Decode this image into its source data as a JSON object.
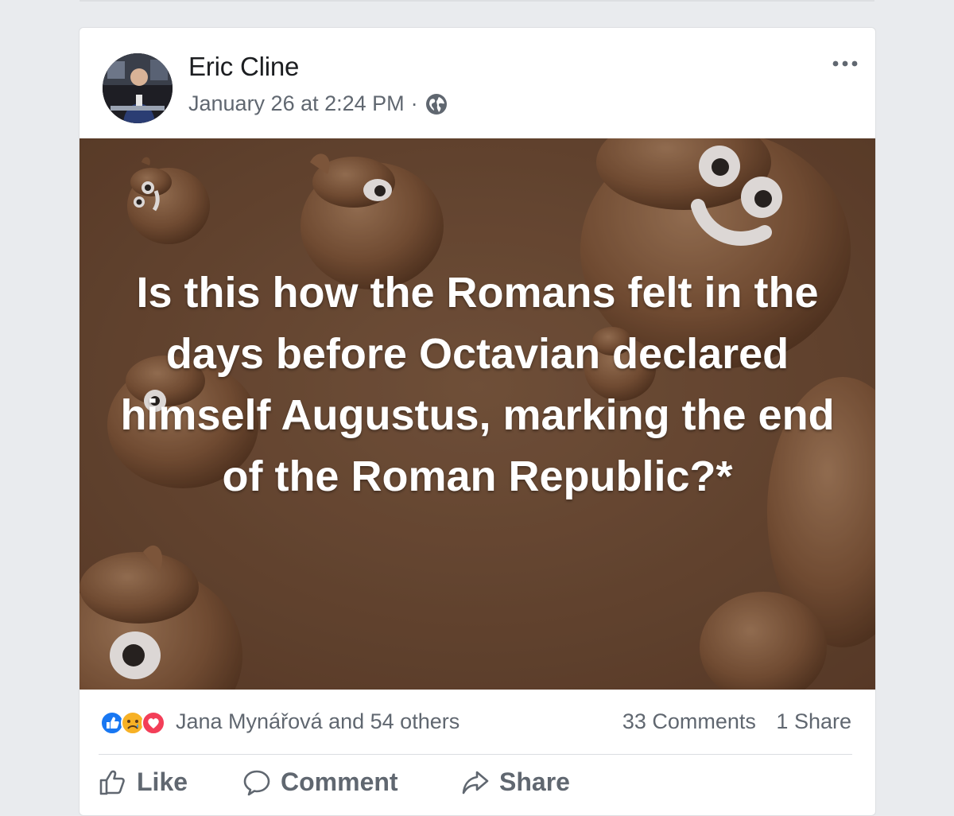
{
  "post": {
    "author": "Eric Cline",
    "timestamp": "January 26 at 2:24 PM",
    "separator": "·",
    "privacy_icon": "globe-icon",
    "options_icon": "more-icon",
    "image_text": "Is this how the Romans felt in the days before Octavian declared himself Augustus, marking the end of the Roman Republic?*"
  },
  "engagement": {
    "reaction_icons": [
      "like-reaction-icon",
      "sad-reaction-icon",
      "love-reaction-icon"
    ],
    "reactions_text": "Jana Mynářová and 54 others",
    "comments_text": "33 Comments",
    "shares_text": "1 Share"
  },
  "actions": {
    "like_label": "Like",
    "comment_label": "Comment",
    "share_label": "Share"
  },
  "colors": {
    "background": "#e9ebee",
    "card": "#ffffff",
    "image_brown": "#6d4c35",
    "secondary_text": "#606770",
    "like_blue": "#1877f2",
    "love_red": "#f33e58",
    "sad_yellow": "#f7b125"
  }
}
